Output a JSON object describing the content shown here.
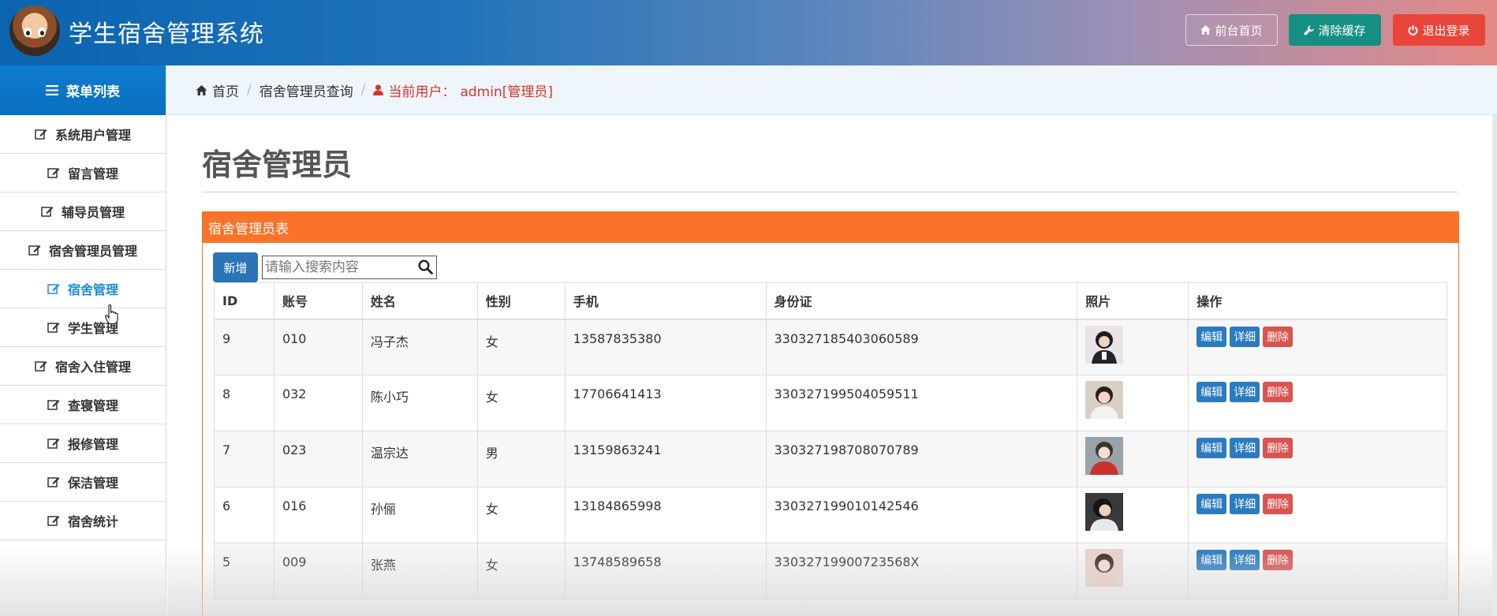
{
  "header": {
    "title": "学生宿舍管理系统",
    "buttons": {
      "home": "前台首页",
      "clear_cache": "清除缓存",
      "logout": "退出登录"
    }
  },
  "sidebar": {
    "heading": "菜单列表",
    "items": [
      {
        "label": "系统用户管理",
        "active": false
      },
      {
        "label": "留言管理",
        "active": false
      },
      {
        "label": "辅导员管理",
        "active": false
      },
      {
        "label": "宿舍管理员管理",
        "active": false
      },
      {
        "label": "宿舍管理",
        "active": true
      },
      {
        "label": "学生管理",
        "active": false
      },
      {
        "label": "宿舍入住管理",
        "active": false
      },
      {
        "label": "查寝管理",
        "active": false
      },
      {
        "label": "报修管理",
        "active": false
      },
      {
        "label": "保洁管理",
        "active": false
      },
      {
        "label": "宿舍统计",
        "active": false
      }
    ]
  },
  "breadcrumb": {
    "home": "首页",
    "current": "宿舍管理员查询",
    "user_prefix": "当前用户：",
    "user": "admin[管理员]"
  },
  "main": {
    "page_title": "宿舍管理员",
    "panel_title": "宿舍管理员表",
    "add_button": "新增",
    "search_placeholder": "请输入搜索内容",
    "columns": [
      "ID",
      "账号",
      "姓名",
      "性别",
      "手机",
      "身份证",
      "照片",
      "操作"
    ],
    "rows": [
      {
        "id": "9",
        "account": "010",
        "name": "冯子杰",
        "gender": "女",
        "phone": "13587835380",
        "idcard": "330327185403060589"
      },
      {
        "id": "8",
        "account": "032",
        "name": "陈小巧",
        "gender": "女",
        "phone": "17706641413",
        "idcard": "330327199504059511"
      },
      {
        "id": "7",
        "account": "023",
        "name": "温宗达",
        "gender": "男",
        "phone": "13159863241",
        "idcard": "330327198708070789"
      },
      {
        "id": "6",
        "account": "016",
        "name": "孙俪",
        "gender": "女",
        "phone": "13184865998",
        "idcard": "330327199010142546"
      },
      {
        "id": "5",
        "account": "009",
        "name": "张燕",
        "gender": "女",
        "phone": "13748589658",
        "idcard": "33032719900723568X"
      }
    ],
    "actions": {
      "edit": "编辑",
      "view": "详细",
      "delete": "删除"
    }
  },
  "colors": {
    "header_start": "#0b64b0",
    "header_end": "#e48a86",
    "menu_head": "#0a6fc0",
    "active_menu": "#1a8cd8",
    "panel_accent": "#f9742a",
    "btn_primary": "#2b7bc0",
    "btn_cache": "#168f83",
    "btn_danger": "#d9534f",
    "user_red": "#d9342b"
  },
  "icons": {
    "home": "home-icon",
    "cache": "wrench-icon",
    "logout": "power-icon",
    "menu": "list-icon",
    "menu_item": "edit-icon",
    "user": "user-icon",
    "search": "search-icon",
    "cursor": "hand-pointer-icon"
  }
}
